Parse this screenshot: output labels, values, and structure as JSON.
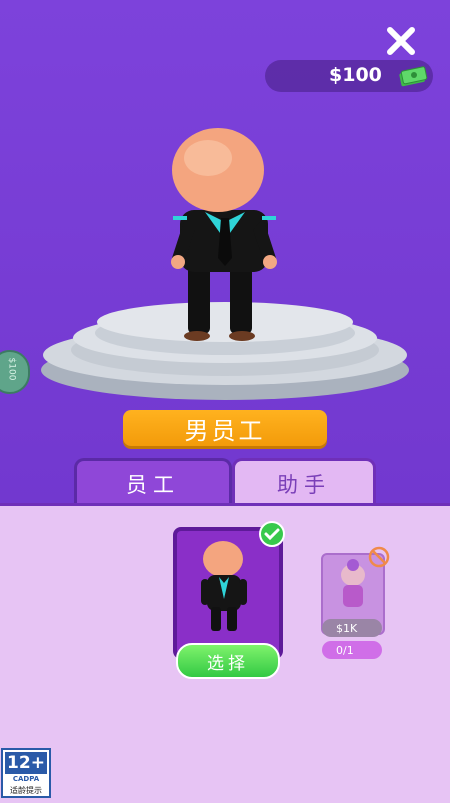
{
  "header": {
    "close_icon": "close-icon",
    "money": "$100",
    "money_icon": "cash-icon"
  },
  "side_button": {
    "text": "$100"
  },
  "character": {
    "name": "男员工"
  },
  "tabs": [
    {
      "label": "员工",
      "active": true
    },
    {
      "label": "助手",
      "active": false
    }
  ],
  "cards": {
    "selected": {
      "button_label": "选择",
      "check_icon": "check-icon"
    },
    "locked": {
      "price": "$1K",
      "ad_progress": "0/1",
      "lock_icon": "lock-icon"
    }
  },
  "age_rating": {
    "label": "12+",
    "org": "CADPA",
    "tip": "适龄提示"
  },
  "colors": {
    "bg": "#7a3fd6",
    "panel": "#e7c4f4",
    "accent_orange": "#ffb21f",
    "green": "#33c944"
  }
}
